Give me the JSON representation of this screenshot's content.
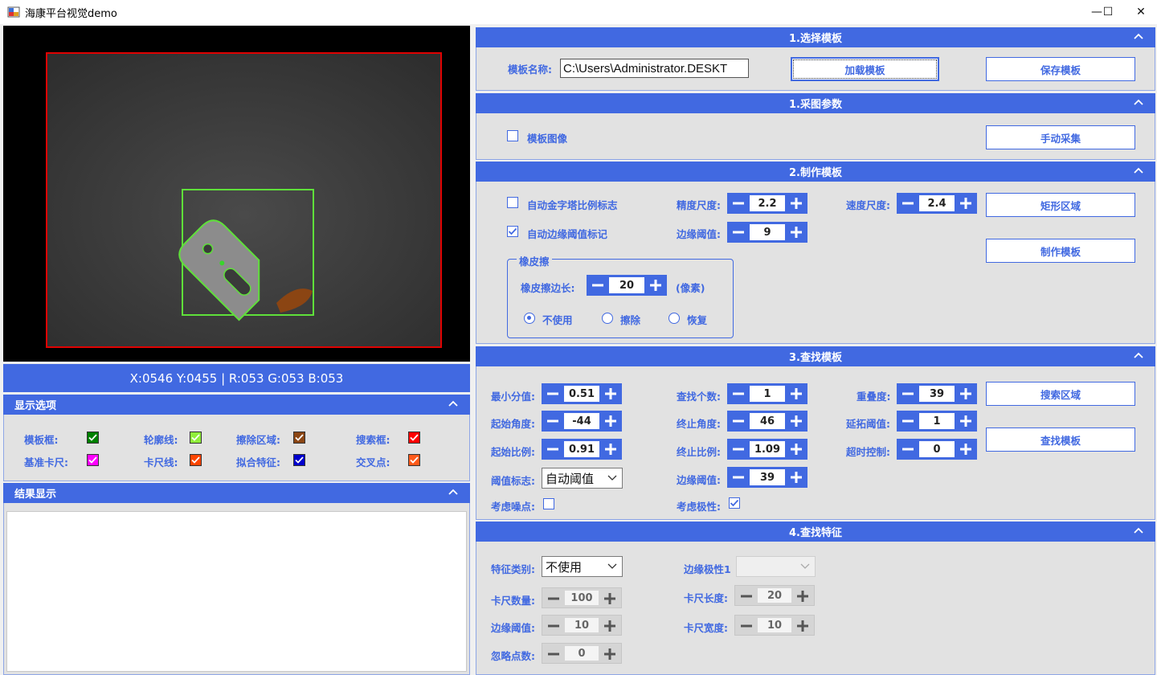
{
  "window": {
    "title": "海康平台视觉demo",
    "minimize_glyph": "—",
    "maximize_glyph": "☐",
    "close_glyph": "✕"
  },
  "colors": {
    "accent": "#4169e1",
    "panel_bg": "#e2e2e2",
    "model_frame": "#008000",
    "contour": "#90ee3a",
    "erase_region": "#8b4513",
    "search_frame": "#ff0000",
    "ref_caliper": "#ff00ff",
    "caliper_line": "#ff4500",
    "fit_feature": "#0000cd",
    "cross_point": "#ff5a1a"
  },
  "viewer": {
    "coord_readout": "X:0546 Y:0455 | R:053 G:053 B:053"
  },
  "display_options": {
    "title": "显示选项",
    "items": [
      {
        "label": "模板框:",
        "color": "#008000"
      },
      {
        "label": "轮廓线:",
        "color": "#90ee3a"
      },
      {
        "label": "擦除区域:",
        "color": "#8b4513"
      },
      {
        "label": "搜索框:",
        "color": "#ff0000"
      },
      {
        "label": "基准卡尺:",
        "color": "#ff00ff"
      },
      {
        "label": "卡尺线:",
        "color": "#ff4500"
      },
      {
        "label": "拟合特征:",
        "color": "#0000cd"
      },
      {
        "label": "交叉点:",
        "color": "#ff5a1a"
      }
    ]
  },
  "result": {
    "title": "结果显示"
  },
  "select_template": {
    "title": "1.选择模板",
    "name_label": "模板名称:",
    "name_value": "C:\\Users\\Administrator.DESKT",
    "load_button": "加载模板",
    "save_button": "保存模板"
  },
  "capture_params": {
    "title": "1.采图参数",
    "template_image_label": "模板图像",
    "manual_capture_button": "手动采集"
  },
  "make_template": {
    "title": "2.制作模板",
    "auto_pyramid_label": "自动金字塔比例标志",
    "auto_edge_label": "自动边缘阈值标记",
    "precision_label": "精度尺度:",
    "precision_value": "2.2",
    "speed_label": "速度尺度:",
    "speed_value": "2.4",
    "edge_threshold_label": "边缘阈值:",
    "edge_threshold_value": "9",
    "rect_region_button": "矩形区域",
    "make_button": "制作模板",
    "eraser": {
      "legend": "橡皮擦",
      "side_label": "橡皮擦边长:",
      "side_value": "20",
      "unit": "(像素)",
      "options": [
        "不使用",
        "擦除",
        "恢复"
      ]
    }
  },
  "find_template": {
    "title": "3.查找模板",
    "min_score_label": "最小分值:",
    "min_score": "0.51",
    "count_label": "查找个数:",
    "count": "1",
    "overlap_label": "重叠度:",
    "overlap": "39",
    "start_angle_label": "起始角度:",
    "start_angle": "-44",
    "end_angle_label": "终止角度:",
    "end_angle": "46",
    "extend_label": "延拓阈值:",
    "extend": "1",
    "start_scale_label": "起始比例:",
    "start_scale": "0.91",
    "end_scale_label": "终止比例:",
    "end_scale": "1.09",
    "timeout_label": "超时控制:",
    "timeout": "0",
    "threshold_flag_label": "阈值标志:",
    "threshold_flag": "自动阈值",
    "edge_threshold_label": "边缘阈值:",
    "edge_threshold": "39",
    "noise_label": "考虑噪点:",
    "polarity_label": "考虑极性:",
    "search_region_button": "搜索区域",
    "find_button": "查找模板"
  },
  "find_feature": {
    "title": "4.查找特征",
    "type_label": "特征类别:",
    "type_value": "不使用",
    "polarity_label": "边缘极性1",
    "polarity_value": "",
    "caliper_count_label": "卡尺数量:",
    "caliper_count": "100",
    "caliper_length_label": "卡尺长度:",
    "caliper_length": "20",
    "edge_threshold_label": "边缘阈值:",
    "edge_threshold": "10",
    "caliper_width_label": "卡尺宽度:",
    "caliper_width": "10",
    "ignore_points_label": "忽略点数:",
    "ignore_points": "0"
  }
}
